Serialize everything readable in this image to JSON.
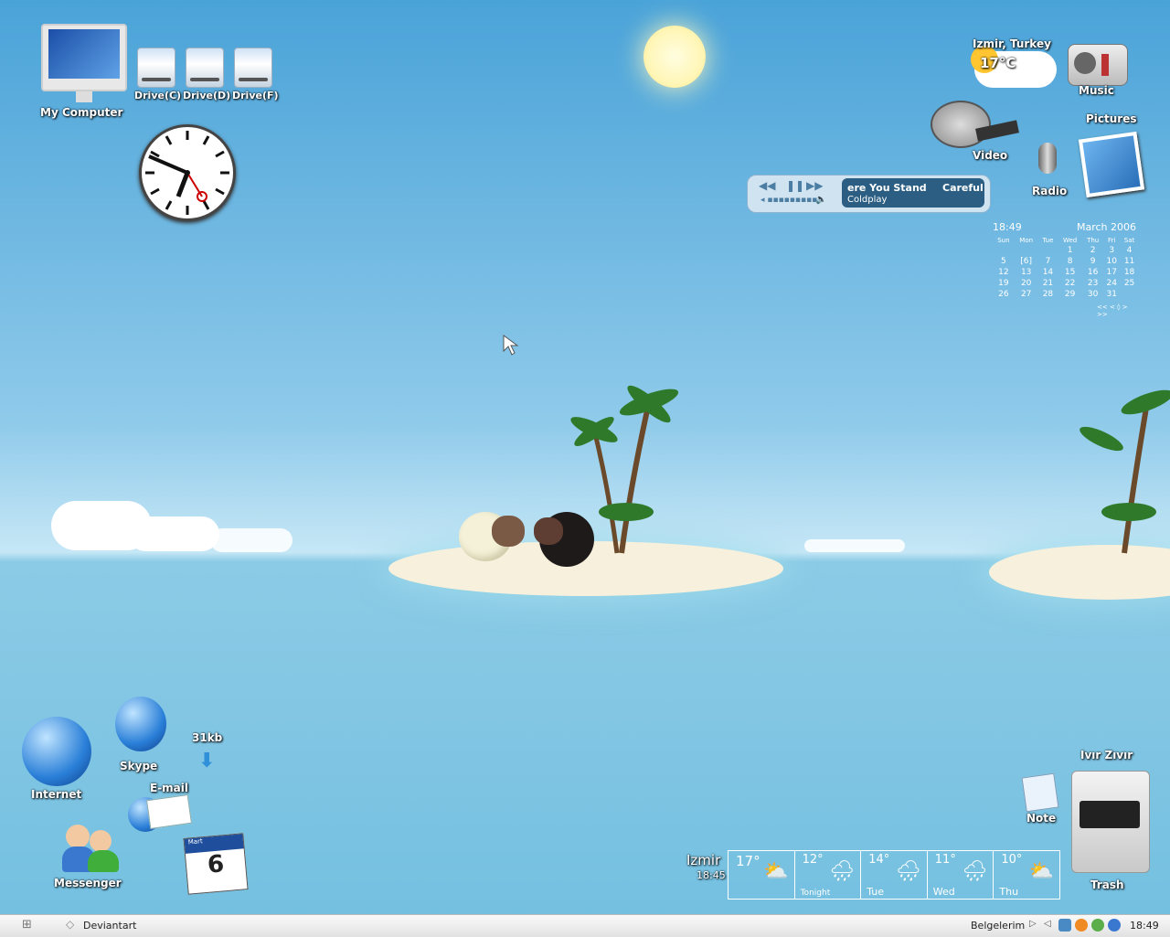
{
  "desktop": {
    "icons": {
      "my_computer": "My Computer",
      "drives": [
        "Drive(C)",
        "Drive(D)",
        "Drive(F)"
      ],
      "music": "Music",
      "video": "Video",
      "pictures": "Pictures",
      "radio": "Radio",
      "internet": "Internet",
      "skype": "Skype",
      "email": "E-mail",
      "messenger": "Messenger",
      "note": "Note",
      "trash": "Trash",
      "trash_title": "Ivır Zıvır"
    },
    "download_meter": "31kb",
    "calendar_icon": {
      "month": "Mart",
      "day": "6"
    }
  },
  "weather_widget": {
    "location": "Izmir, Turkey",
    "temp": "17°C"
  },
  "media_player": {
    "title": "ere You Stand",
    "title2": "Careful",
    "artist": "Coldplay",
    "controls": [
      "prev-icon",
      "pause-icon",
      "next-icon",
      "volume-icon"
    ]
  },
  "calendar": {
    "time": "18:49",
    "month_year": "March 2006",
    "weekdays": [
      "Sun",
      "Mon",
      "Tue",
      "Wed",
      "Thu",
      "Fri",
      "Sat"
    ],
    "weeks": [
      [
        "",
        "",
        "",
        "1",
        "2",
        "3",
        "4"
      ],
      [
        "5",
        "[6]",
        "7",
        "8",
        "9",
        "10",
        "11"
      ],
      [
        "12",
        "13",
        "14",
        "15",
        "16",
        "17",
        "18"
      ],
      [
        "19",
        "20",
        "21",
        "22",
        "23",
        "24",
        "25"
      ],
      [
        "26",
        "27",
        "28",
        "29",
        "30",
        "31",
        ""
      ]
    ],
    "nav": "<< < ◊ > >>"
  },
  "forecast": {
    "city": "Izmir",
    "time": "18:45",
    "days": [
      {
        "temp": "17°",
        "label": "",
        "icon": "sun-cloud-icon"
      },
      {
        "temp": "12°",
        "label": "Tonight",
        "icon": "moon-rain-icon"
      },
      {
        "temp": "14°",
        "label": "Tue",
        "icon": "rain-icon"
      },
      {
        "temp": "11°",
        "label": "Wed",
        "icon": "rain-icon"
      },
      {
        "temp": "10°",
        "label": "Thu",
        "icon": "sun-cloud-icon"
      }
    ]
  },
  "taskbar": {
    "task": "Deviantart",
    "folder": "Belgelerim",
    "clock": "18:49"
  },
  "colors": {
    "sky": "#4aa3d8",
    "sea": "#73bfe0",
    "sand": "#f6f0dc"
  }
}
